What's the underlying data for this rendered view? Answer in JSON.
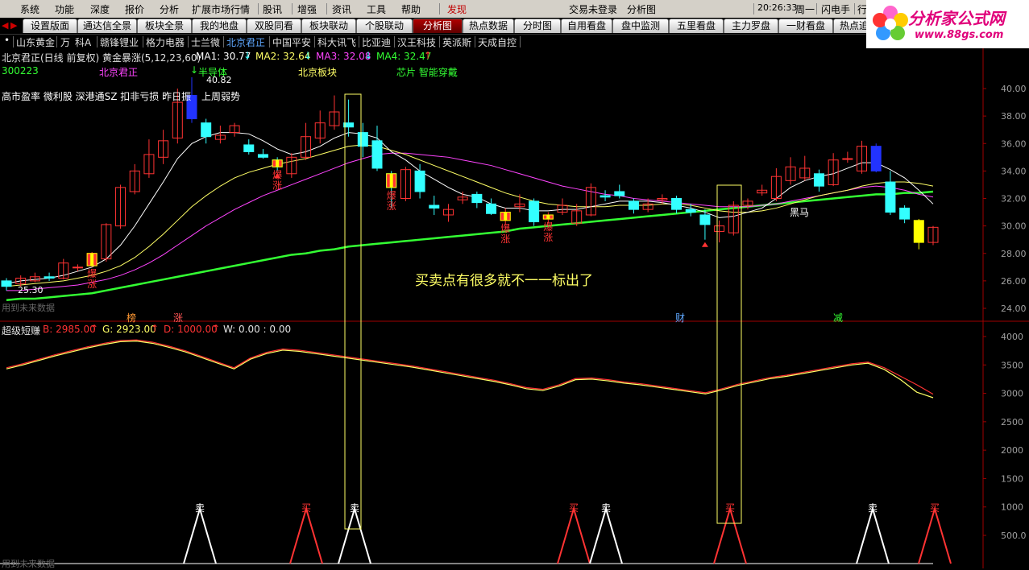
{
  "menu": {
    "items": [
      "系统",
      "功能",
      "深度",
      "报价",
      "分析",
      "扩展市场行情",
      "股讯",
      "增强",
      "资讯",
      "工具",
      "帮助",
      "发现"
    ],
    "login_status": "交易未登录",
    "view_name": "分析图",
    "time": "20:26:33",
    "weekday": "周一",
    "flash_button": "闪电手",
    "hang_button": "行"
  },
  "tabs": [
    "设置版面",
    "通达信全景",
    "板块全景",
    "我的地盘",
    "双股同看",
    "板块联动",
    "个股联动",
    "分析图",
    "热点数据",
    "分时图",
    "自用看盘",
    "盘中监测",
    "五里看盘",
    "主力罗盘",
    "一财看盘",
    "热点追"
  ],
  "active_tab": "分析图",
  "stocks": [
    "山东黄金",
    "万",
    "科A",
    "赣锋锂业",
    "格力电器",
    "士兰微",
    "北京君正",
    "中国平安",
    "科大讯飞",
    "比亚迪",
    "汉王科技",
    "英派斯",
    "天成自控"
  ],
  "selected_stock": "北京君正",
  "logo": {
    "title": "分析家公式网",
    "url_text": "www.88gs.com"
  },
  "main_chart": {
    "header": "北京君正(日线 前复权) 黄金暴涨(5,12,23,60)",
    "ma1_label": "MA1: 30.77",
    "ma2_label": "MA2: 32.64",
    "ma3_label": "MA3: 32.08",
    "ma4_label": "MA4: 32.47",
    "code": "300223",
    "name_tag": "北京君正",
    "concept_tag": "半导体",
    "high_value": "40.82",
    "sector_tag": "北京板块",
    "chip_tag": "芯片 智能穿戴",
    "info_line_left": "高市盈率 微利股 深港通SZ 扣非亏损 昨日振",
    "info_line_right": "上周弱势",
    "low_value": "25.30",
    "annotation": "买卖点有很多就不一一标出了",
    "marker_bao": "爆",
    "marker_zhang": "涨",
    "marker_heima": "黑马",
    "bottom_tags": [
      "榜",
      "涨",
      "财",
      "减"
    ],
    "future_data": "用到未来数据",
    "colors": {
      "ma1": "#ffffff",
      "ma2": "#ffff66",
      "ma3": "#ff44ff",
      "ma4": "#33ff33",
      "up": "#ff3333",
      "down": "#33ffff"
    }
  },
  "chart_data": {
    "type": "candlestick",
    "ylim": [
      23,
      41
    ],
    "yticks": [
      "40.00",
      "38.00",
      "36.00",
      "34.00",
      "32.00",
      "30.00",
      "28.00",
      "26.00",
      "24.00"
    ],
    "candles": [
      {
        "o": 26.0,
        "c": 25.6,
        "h": 26.2,
        "l": 25.3
      },
      {
        "o": 25.8,
        "c": 26.2,
        "h": 26.4,
        "l": 25.6
      },
      {
        "o": 26.0,
        "c": 26.3,
        "h": 26.6,
        "l": 25.9
      },
      {
        "o": 26.3,
        "c": 26.2,
        "h": 26.6,
        "l": 26.0
      },
      {
        "o": 26.2,
        "c": 27.3,
        "h": 27.6,
        "l": 26.1
      },
      {
        "o": 27.0,
        "c": 27.0,
        "h": 27.2,
        "l": 26.7
      },
      {
        "o": 27.1,
        "c": 28.0,
        "h": 28.1,
        "l": 27.0
      },
      {
        "o": 27.6,
        "c": 30.1,
        "h": 30.2,
        "l": 27.4
      },
      {
        "o": 30.0,
        "c": 32.8,
        "h": 33.0,
        "l": 29.8
      },
      {
        "o": 32.5,
        "c": 34.0,
        "h": 34.5,
        "l": 32.3
      },
      {
        "o": 33.8,
        "c": 35.2,
        "h": 36.3,
        "l": 33.5
      },
      {
        "o": 35.0,
        "c": 36.2,
        "h": 37.0,
        "l": 34.5
      },
      {
        "o": 36.4,
        "c": 39.0,
        "h": 40.0,
        "l": 36.0
      },
      {
        "o": 39.5,
        "c": 37.8,
        "h": 40.82,
        "l": 37.5
      },
      {
        "o": 37.5,
        "c": 36.5,
        "h": 37.8,
        "l": 36.0
      },
      {
        "o": 36.3,
        "c": 36.6,
        "h": 37.3,
        "l": 36.0
      },
      {
        "o": 36.8,
        "c": 37.3,
        "h": 37.5,
        "l": 36.5
      },
      {
        "o": 35.9,
        "c": 35.4,
        "h": 36.3,
        "l": 35.2
      },
      {
        "o": 35.2,
        "c": 35.0,
        "h": 35.6,
        "l": 34.9
      },
      {
        "o": 34.8,
        "c": 34.3,
        "h": 35.0,
        "l": 34.0
      },
      {
        "o": 33.8,
        "c": 35.0,
        "h": 35.3,
        "l": 33.5
      },
      {
        "o": 35.0,
        "c": 36.5,
        "h": 37.5,
        "l": 34.8
      },
      {
        "o": 36.4,
        "c": 37.5,
        "h": 38.4,
        "l": 36.0
      },
      {
        "o": 37.3,
        "c": 38.3,
        "h": 39.5,
        "l": 37.0
      },
      {
        "o": 37.5,
        "c": 37.2,
        "h": 39.2,
        "l": 36.5
      },
      {
        "o": 36.8,
        "c": 35.8,
        "h": 37.5,
        "l": 35.0
      },
      {
        "o": 36.2,
        "c": 34.2,
        "h": 37.3,
        "l": 34.0
      },
      {
        "o": 33.8,
        "c": 32.8,
        "h": 34.0,
        "l": 31.3
      },
      {
        "o": 32.0,
        "c": 34.1,
        "h": 34.3,
        "l": 31.8
      },
      {
        "o": 34.0,
        "c": 32.5,
        "h": 34.5,
        "l": 32.0
      },
      {
        "o": 31.5,
        "c": 31.3,
        "h": 32.2,
        "l": 30.8
      },
      {
        "o": 30.8,
        "c": 31.2,
        "h": 31.6,
        "l": 30.3
      },
      {
        "o": 31.9,
        "c": 32.1,
        "h": 32.5,
        "l": 31.6
      },
      {
        "o": 32.3,
        "c": 31.7,
        "h": 32.5,
        "l": 31.3
      },
      {
        "o": 31.6,
        "c": 30.9,
        "h": 32.0,
        "l": 30.8
      },
      {
        "o": 30.4,
        "c": 31.0,
        "h": 31.3,
        "l": 30.1
      },
      {
        "o": 31.4,
        "c": 31.6,
        "h": 32.3,
        "l": 31.0
      },
      {
        "o": 31.8,
        "c": 30.3,
        "h": 32.0,
        "l": 30.0
      },
      {
        "o": 30.5,
        "c": 30.8,
        "h": 31.0,
        "l": 30.2
      },
      {
        "o": 31.0,
        "c": 31.5,
        "h": 32.0,
        "l": 30.8
      },
      {
        "o": 30.2,
        "c": 31.1,
        "h": 31.6,
        "l": 30.0
      },
      {
        "o": 30.8,
        "c": 32.8,
        "h": 33.1,
        "l": 30.7
      },
      {
        "o": 32.2,
        "c": 32.1,
        "h": 32.6,
        "l": 31.8
      },
      {
        "o": 32.5,
        "c": 32.2,
        "h": 33.0,
        "l": 32.0
      },
      {
        "o": 31.8,
        "c": 31.2,
        "h": 32.0,
        "l": 30.9
      },
      {
        "o": 31.2,
        "c": 31.6,
        "h": 32.0,
        "l": 31.0
      },
      {
        "o": 31.9,
        "c": 32.0,
        "h": 32.3,
        "l": 31.6
      },
      {
        "o": 32.0,
        "c": 31.2,
        "h": 32.2,
        "l": 30.9
      },
      {
        "o": 31.2,
        "c": 31.0,
        "h": 31.6,
        "l": 30.7
      },
      {
        "o": 30.8,
        "c": 30.1,
        "h": 31.2,
        "l": 29.0
      },
      {
        "o": 29.6,
        "c": 30.0,
        "h": 30.4,
        "l": 28.8
      },
      {
        "o": 29.5,
        "c": 31.5,
        "h": 31.8,
        "l": 29.3
      },
      {
        "o": 31.5,
        "c": 31.8,
        "h": 32.0,
        "l": 31.2
      },
      {
        "o": 32.4,
        "c": 32.6,
        "h": 33.0,
        "l": 32.2
      },
      {
        "o": 32.0,
        "c": 33.6,
        "h": 34.2,
        "l": 31.8
      },
      {
        "o": 33.3,
        "c": 34.3,
        "h": 35.0,
        "l": 33.0
      },
      {
        "o": 33.5,
        "c": 34.2,
        "h": 35.1,
        "l": 33.3
      },
      {
        "o": 33.8,
        "c": 32.9,
        "h": 34.1,
        "l": 32.5
      },
      {
        "o": 33.0,
        "c": 34.8,
        "h": 35.3,
        "l": 32.9
      },
      {
        "o": 34.9,
        "c": 34.9,
        "h": 35.4,
        "l": 34.6
      },
      {
        "o": 34.0,
        "c": 35.8,
        "h": 36.2,
        "l": 33.8
      },
      {
        "o": 35.8,
        "c": 34.0,
        "h": 36.0,
        "l": 33.9
      },
      {
        "o": 33.2,
        "c": 31.0,
        "h": 34.0,
        "l": 30.8
      },
      {
        "o": 31.3,
        "c": 30.5,
        "h": 31.5,
        "l": 30.2
      },
      {
        "o": 30.4,
        "c": 28.8,
        "h": 30.5,
        "l": 28.3
      },
      {
        "o": 28.8,
        "c": 29.9,
        "h": 30.0,
        "l": 28.6
      }
    ],
    "ma1": [
      25.8,
      26.0,
      26.1,
      26.2,
      26.4,
      26.7,
      27.0,
      27.6,
      28.6,
      30.0,
      31.6,
      33.2,
      34.9,
      36.0,
      36.5,
      36.8,
      36.8,
      36.7,
      36.2,
      35.6,
      35.2,
      35.4,
      35.8,
      36.4,
      36.8,
      36.7,
      36.4,
      35.4,
      34.8,
      34.0,
      33.4,
      32.8,
      32.3,
      32.1,
      31.6,
      31.3,
      31.3,
      31.1,
      31.1,
      31.2,
      31.2,
      31.4,
      31.6,
      31.8,
      31.8,
      31.8,
      31.7,
      31.5,
      31.3,
      31.0,
      30.6,
      30.7,
      31.0,
      31.3,
      32.0,
      32.8,
      33.3,
      33.6,
      33.8,
      34.2,
      34.6,
      34.6,
      34.1,
      33.5,
      32.6,
      31.6
    ],
    "ma2": [
      25.6,
      25.7,
      25.8,
      25.9,
      26.0,
      26.2,
      26.4,
      26.7,
      27.1,
      27.7,
      28.5,
      29.4,
      30.4,
      31.4,
      32.2,
      32.9,
      33.5,
      33.9,
      34.2,
      34.5,
      34.7,
      34.9,
      35.2,
      35.5,
      35.8,
      35.9,
      35.8,
      35.5,
      35.2,
      34.8,
      34.4,
      34.0,
      33.6,
      33.2,
      32.8,
      32.4,
      32.1,
      31.8,
      31.6,
      31.5,
      31.4,
      31.4,
      31.4,
      31.5,
      31.5,
      31.5,
      31.6,
      31.6,
      31.5,
      31.3,
      31.1,
      31.0,
      31.0,
      31.1,
      31.3,
      31.6,
      31.9,
      32.2,
      32.4,
      32.6,
      32.9,
      33.1,
      33.2,
      33.2,
      33.1,
      32.9
    ],
    "ma3": [
      25.3,
      25.3,
      25.4,
      25.5,
      25.6,
      25.7,
      25.9,
      26.1,
      26.4,
      26.8,
      27.3,
      27.9,
      28.6,
      29.3,
      30.0,
      30.6,
      31.2,
      31.7,
      32.2,
      32.6,
      33.0,
      33.4,
      33.8,
      34.2,
      34.6,
      34.9,
      35.2,
      35.3,
      35.3,
      35.2,
      35.1,
      35.0,
      34.8,
      34.6,
      34.4,
      34.1,
      33.8,
      33.5,
      33.2,
      32.9,
      32.7,
      32.5,
      32.3,
      32.2,
      32.0,
      31.9,
      31.8,
      31.7,
      31.6,
      31.5,
      31.4,
      31.4,
      31.4,
      31.5,
      31.6,
      31.8,
      32.0,
      32.2,
      32.4,
      32.6,
      32.8,
      32.9,
      32.8,
      32.6,
      32.3,
      32.1
    ],
    "ma4": [
      24.6,
      24.7,
      24.7,
      24.8,
      24.9,
      25.0,
      25.1,
      25.3,
      25.5,
      25.7,
      25.9,
      26.1,
      26.3,
      26.5,
      26.7,
      26.9,
      27.1,
      27.3,
      27.5,
      27.7,
      27.9,
      28.0,
      28.2,
      28.3,
      28.5,
      28.6,
      28.7,
      28.8,
      28.9,
      29.0,
      29.1,
      29.2,
      29.3,
      29.4,
      29.5,
      29.6,
      29.8,
      29.9,
      30.0,
      30.1,
      30.2,
      30.3,
      30.4,
      30.5,
      30.6,
      30.7,
      30.8,
      30.9,
      31.0,
      31.1,
      31.2,
      31.3,
      31.4,
      31.5,
      31.6,
      31.7,
      31.8,
      31.9,
      32.0,
      32.1,
      32.2,
      32.3,
      32.3,
      32.4,
      32.4,
      32.5
    ]
  },
  "sub_chart": {
    "name": "超级短赚",
    "b_label": "B: 2985.00",
    "g_label": "G: 2923.00",
    "d_label": "D: 1000.00",
    "w_label": "W: 0.00 : 0.00",
    "sell_label": "卖",
    "buy_label": "买",
    "future_data": "用到未来数据",
    "yticks": [
      "4000",
      "3500",
      "3000",
      "2500",
      "2000",
      "1500",
      "1000",
      "500.0"
    ],
    "ylim": [
      250,
      4250
    ],
    "b_series": [
      3450,
      3520,
      3600,
      3680,
      3750,
      3820,
      3880,
      3930,
      3940,
      3900,
      3830,
      3750,
      3650,
      3550,
      3450,
      3620,
      3720,
      3780,
      3760,
      3720,
      3680,
      3640,
      3600,
      3560,
      3520,
      3480,
      3430,
      3380,
      3330,
      3280,
      3230,
      3170,
      3100,
      3070,
      3150,
      3260,
      3270,
      3240,
      3200,
      3170,
      3130,
      3090,
      3050,
      3010,
      3080,
      3160,
      3220,
      3280,
      3320,
      3370,
      3420,
      3470,
      3520,
      3550,
      3450,
      3300,
      3150,
      2985
    ],
    "g_series": [
      3430,
      3500,
      3580,
      3660,
      3730,
      3800,
      3860,
      3910,
      3920,
      3880,
      3810,
      3730,
      3630,
      3530,
      3430,
      3600,
      3700,
      3760,
      3740,
      3700,
      3660,
      3620,
      3580,
      3540,
      3500,
      3460,
      3410,
      3360,
      3310,
      3260,
      3210,
      3150,
      3080,
      3050,
      3130,
      3240,
      3250,
      3220,
      3180,
      3150,
      3110,
      3070,
      3030,
      2990,
      3060,
      3140,
      3200,
      3260,
      3300,
      3350,
      3400,
      3450,
      3500,
      3530,
      3420,
      3240,
      3020,
      2923
    ],
    "signals": [
      {
        "type": "sell",
        "x": 248
      },
      {
        "type": "buy",
        "x": 380
      },
      {
        "type": "sell",
        "x": 440
      },
      {
        "type": "buy",
        "x": 712
      },
      {
        "type": "sell",
        "x": 752
      },
      {
        "type": "buy",
        "x": 906
      },
      {
        "type": "sell",
        "x": 1083
      },
      {
        "type": "buy",
        "x": 1160
      }
    ]
  }
}
